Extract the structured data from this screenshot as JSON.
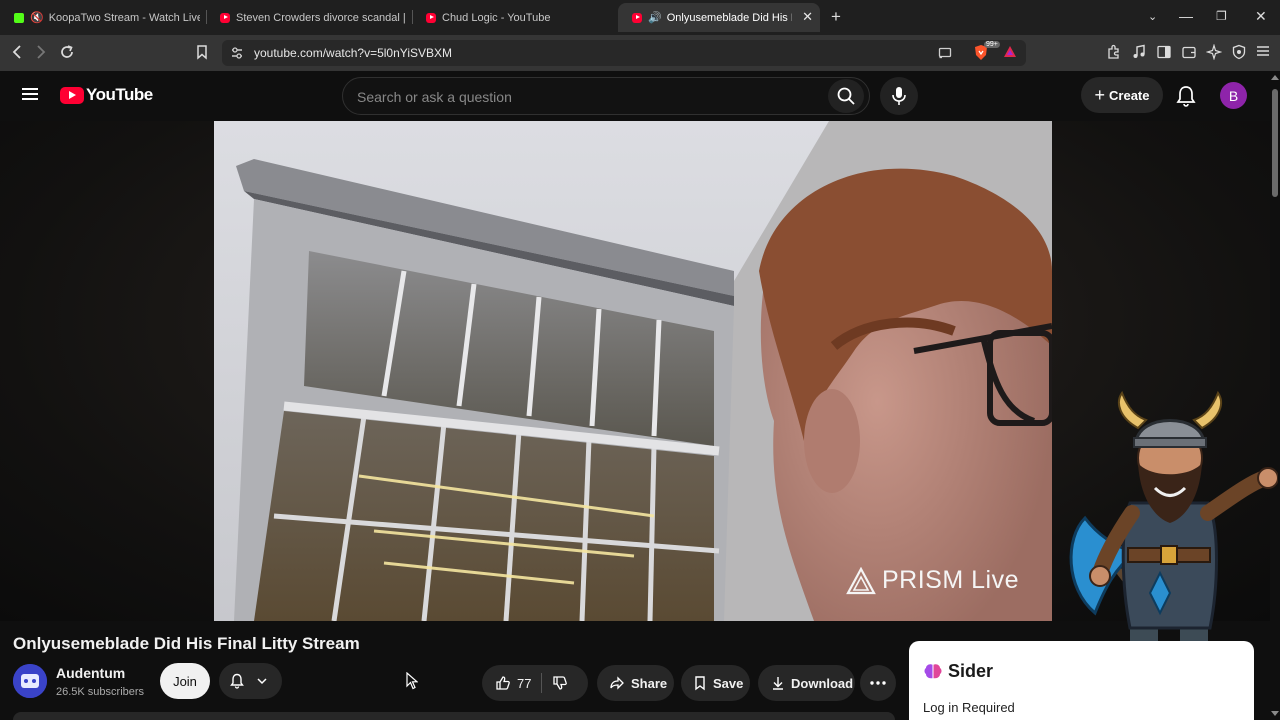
{
  "browser": {
    "tabs": [
      {
        "title": "KoopaTwo Stream - Watch Live on",
        "icon": "kick-icon",
        "muted": true
      },
      {
        "title": "Steven Crowders divorce scandal | RE",
        "icon": "youtube-icon",
        "muted": false
      },
      {
        "title": "Chud Logic - YouTube",
        "icon": "youtube-icon",
        "muted": false
      },
      {
        "title": "Onlyusemeblade Did His Final",
        "icon": "youtube-icon",
        "audio": true,
        "active": true
      }
    ],
    "url": "youtube.com/watch?v=5l0nYiSVBXM",
    "extension_badge": "99+"
  },
  "youtube": {
    "logo_text": "YouTube",
    "search_placeholder": "Search or ask a question",
    "create_label": "Create",
    "avatar_letter": "B"
  },
  "video": {
    "watermark": "PRISM Live",
    "title": "Onlyusemeblade Did His Final Litty Stream"
  },
  "channel": {
    "name": "Audentum",
    "subscribers": "26.5K subscribers",
    "join_label": "Join"
  },
  "actions": {
    "likes": "77",
    "share_label": "Share",
    "save_label": "Save",
    "download_label": "Download"
  },
  "sider": {
    "brand": "Sider",
    "message": "Log in Required"
  },
  "colors": {
    "youtube_red": "#ff0033",
    "avatar_purple": "#8e24aa",
    "kick_green": "#53fc18"
  }
}
